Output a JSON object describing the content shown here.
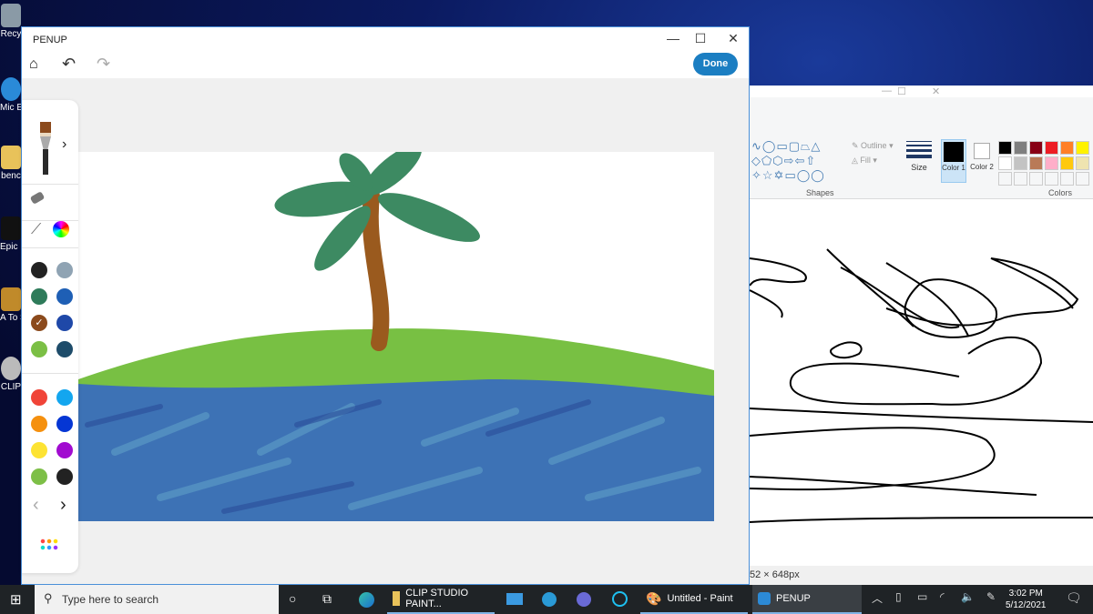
{
  "desktop": {
    "icons": [
      {
        "label": "Recy"
      },
      {
        "label": "Mic E"
      },
      {
        "label": "benc"
      },
      {
        "label": "Epic Lau"
      },
      {
        "label": "A To Sag"
      },
      {
        "label": "CLIP"
      }
    ]
  },
  "paint": {
    "title_controls": [
      "—",
      "☐",
      "✕"
    ],
    "shapes": {
      "group_label": "Shapes",
      "outline_label": "Outline",
      "fill_label": "Fill"
    },
    "size_label": "Size",
    "color1_label": "Color 1",
    "color2_label": "Color 2",
    "colors_label": "Colors",
    "palette": [
      "#000000",
      "#7f7f7f",
      "#880015",
      "#ed1c24",
      "#ff7f27",
      "#fff200",
      "#ffffff",
      "#c3c3c3",
      "#b97a57",
      "#ffaec9",
      "#ffc90e",
      "#efe4b0"
    ],
    "status_size": "52 × 648px"
  },
  "penup": {
    "title": "PENUP",
    "controls": {
      "minimize": "—",
      "maximize": "☐",
      "close": "✕"
    },
    "done_label": "Done",
    "tools": {
      "brush": "flat-brush",
      "eraser": "eraser",
      "eyedropper": "eyedropper",
      "color_wheel": "color-wheel"
    },
    "palette1": [
      "#222222",
      "#8fa3b3",
      "#2e7b5a",
      "#1e5fb5",
      "#8b4a1c",
      "#1f48a8",
      "#7bbf45",
      "#1e4c6a"
    ],
    "palette1_selected": 4,
    "palette2": [
      "#f04438",
      "#13a6ef",
      "#f5900e",
      "#0536d4",
      "#fde333",
      "#a10bd0",
      "#7dbf47",
      "#222222"
    ],
    "pager": {
      "prev": "‹",
      "next": "›"
    }
  },
  "taskbar": {
    "search_placeholder": "Type here to search",
    "apps": [
      {
        "label": "CLIP STUDIO PAINT..."
      },
      {
        "label": "Untitled - Paint"
      },
      {
        "label": "PENUP"
      }
    ],
    "time": "3:02 PM",
    "date": "5/12/2021"
  }
}
